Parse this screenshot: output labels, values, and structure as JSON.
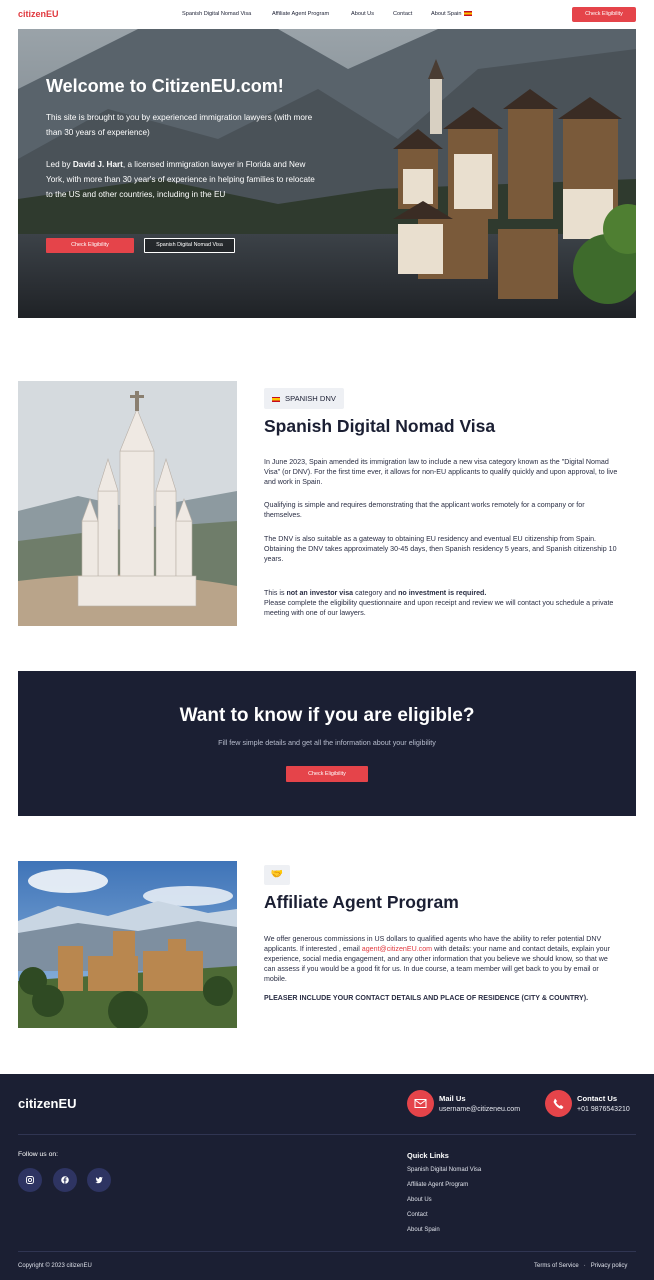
{
  "nav": {
    "logo": "citizenEU",
    "links": [
      "Spanish Digital Nomad Visa",
      "Affiliate Agent Program",
      "About Us",
      "Contact",
      "About Spain"
    ],
    "cta": "Check Eligibility"
  },
  "hero": {
    "title": "Welcome to CitizenEU.com!",
    "intro": "This site is brought to you by experienced immigration lawyers (with more than 30 years of experience)",
    "led_prefix": "Led by ",
    "led_name": "David J. Hart",
    "led_rest": ", a licensed immigration lawyer in Florida and New York, with more than 30 year's of experience in helping families to relocate to the US and other countries, including in the EU",
    "btn_primary": "Check Eligibility",
    "btn_secondary": "Spanish Digital Nomad Visa"
  },
  "dnv": {
    "tag": "SPANISH DNV",
    "title": "Spanish Digital Nomad Visa",
    "p1": "In June 2023, Spain amended its immigration law to include a new visa category known as the \"Digital Nomad Visa\" (or DNV). For the first time ever, it allows for non-EU applicants to qualify quickly and upon approval, to live and work in Spain.",
    "p2": "Qualifying is simple and requires demonstrating that the applicant works remotely for a company or for themselves.",
    "p3a": "The DNV is also suitable as a gateway to obtaining EU residency and eventual EU citizenship from Spain.",
    "p3b": "Obtaining the DNV takes approximately 30-45 days, then Spanish residency 5 years, and Spanish citizenship 10 years.",
    "p4_prefix": "This is ",
    "p4_bold1": "not an investor visa",
    "p4_mid": " category and ",
    "p4_bold2": "no investment is required.",
    "p4b": "Please complete the eligibility questionnaire and upon receipt and review we will contact you schedule a private meeting with one of our lawyers."
  },
  "banner": {
    "title": "Want to know if you are eligible?",
    "subtitle": "Fill few simple details and get all the information about your eligibility",
    "cta": "Check Eligibility"
  },
  "affiliate": {
    "tag_icon": "🤝",
    "title": "Affiliate Agent Program",
    "p1_prefix": "We offer generous commissions in US dollars to qualified agents who have the ability to refer potential DNV applicants. If interested , email ",
    "email": "agent@citizenEU.com",
    "p1_rest": " with details: your name and contact details, explain your experience, social media engagement, and any other information that you believe we should know, so that we can assess if you would be a good fit for us. In due course, a team member will get back to you by email or mobile.",
    "p2": "PLEASER INCLUDE YOUR CONTACT DETAILS AND PLACE OF RESIDENCE (CITY & COUNTRY)."
  },
  "footer": {
    "logo": "citizenEU",
    "mail_title": "Mail Us",
    "mail_value": "username@citizeneu.com",
    "contact_title": "Contact Us",
    "contact_value": "+01 9876543210",
    "follow": "Follow us on:",
    "quick_links_title": "Quick Links",
    "quick_links": [
      "Spanish Digital Nomad Visa",
      "Affiliate Agent Program",
      "About Us",
      "Contact",
      "About Spain"
    ],
    "copyright": "Copyright © 2023 citizenEU",
    "terms": "Terms of Service",
    "privacy": "Privacy policy"
  },
  "colors": {
    "accent": "#e5444a",
    "dark": "#1b1f33"
  },
  "icons": [
    "flag-spain-icon",
    "mail-icon",
    "phone-icon",
    "instagram-icon",
    "facebook-icon",
    "twitter-icon",
    "handshake-icon"
  ]
}
